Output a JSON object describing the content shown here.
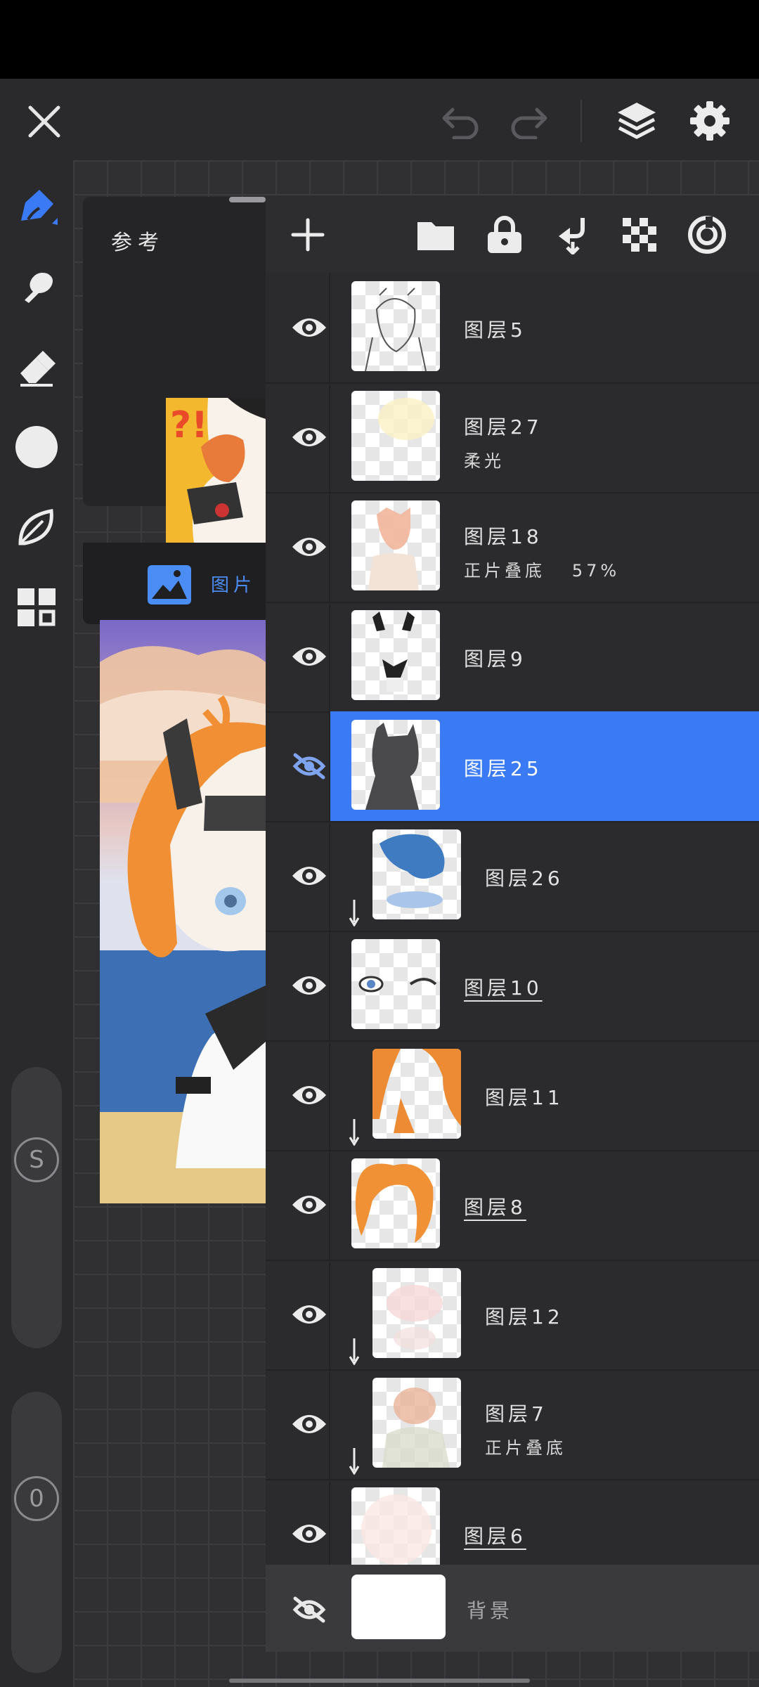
{
  "toolbar": {
    "close_icon": "close-icon",
    "undo_icon": "undo-icon",
    "redo_icon": "redo-icon",
    "layers_icon": "layers-icon",
    "settings_icon": "gear-icon"
  },
  "tools": [
    "brush-icon",
    "smudge-icon",
    "eraser-icon",
    "color-circle-icon",
    "leaf-icon",
    "grid-icon"
  ],
  "sliders": {
    "size_badge": "S",
    "opacity_badge": "0"
  },
  "reference": {
    "title": "参考",
    "image_label": "图片"
  },
  "layer_toolbar": [
    "add-icon",
    "folder-icon",
    "lock-icon",
    "merge-down-icon",
    "transparency-icon",
    "target-icon"
  ],
  "layers": [
    {
      "name": "图层5",
      "sub": "",
      "visible": true,
      "clipped": false,
      "selected": false,
      "underline": false
    },
    {
      "name": "图层27",
      "sub": "柔光",
      "visible": true,
      "clipped": false,
      "selected": false,
      "underline": false
    },
    {
      "name": "图层18",
      "sub": "正片叠底   57%",
      "visible": true,
      "clipped": false,
      "selected": false,
      "underline": false
    },
    {
      "name": "图层9",
      "sub": "",
      "visible": true,
      "clipped": false,
      "selected": false,
      "underline": false
    },
    {
      "name": "图层25",
      "sub": "",
      "visible": false,
      "clipped": false,
      "selected": true,
      "underline": false
    },
    {
      "name": "图层26",
      "sub": "",
      "visible": true,
      "clipped": true,
      "selected": false,
      "underline": false
    },
    {
      "name": "图层10",
      "sub": "",
      "visible": true,
      "clipped": false,
      "selected": false,
      "underline": true
    },
    {
      "name": "图层11",
      "sub": "",
      "visible": true,
      "clipped": true,
      "selected": false,
      "underline": false
    },
    {
      "name": "图层8",
      "sub": "",
      "visible": true,
      "clipped": false,
      "selected": false,
      "underline": true
    },
    {
      "name": "图层12",
      "sub": "",
      "visible": true,
      "clipped": true,
      "selected": false,
      "underline": false
    },
    {
      "name": "图层7",
      "sub": "正片叠底",
      "visible": true,
      "clipped": true,
      "selected": false,
      "underline": false
    },
    {
      "name": "图层6",
      "sub": "",
      "visible": true,
      "clipped": false,
      "selected": false,
      "underline": true
    }
  ],
  "background_layer": {
    "name": "背景",
    "visible": false
  },
  "colors": {
    "accent": "#3a7af5",
    "panel": "#2b2b2d"
  }
}
